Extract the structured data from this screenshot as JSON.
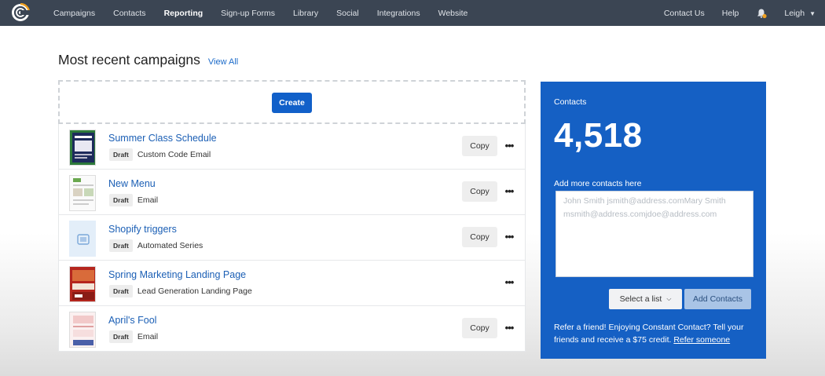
{
  "nav": {
    "items": [
      {
        "label": "Campaigns",
        "active": false
      },
      {
        "label": "Contacts",
        "active": false
      },
      {
        "label": "Reporting",
        "active": true
      },
      {
        "label": "Sign-up Forms",
        "active": false
      },
      {
        "label": "Library",
        "active": false
      },
      {
        "label": "Social",
        "active": false
      },
      {
        "label": "Integrations",
        "active": false
      },
      {
        "label": "Website",
        "active": false
      }
    ],
    "right": {
      "contact_us": "Contact Us",
      "help": "Help",
      "user": "Leigh"
    }
  },
  "campaigns": {
    "heading": "Most recent campaigns",
    "view_all": "View All",
    "create_label": "Create",
    "rows": [
      {
        "title": "Summer Class Schedule",
        "status": "Draft",
        "type": "Custom Code Email",
        "copy": "Copy",
        "thumb": "email-green"
      },
      {
        "title": "New Menu",
        "status": "Draft",
        "type": "Email",
        "copy": "Copy",
        "thumb": "email-light"
      },
      {
        "title": "Shopify triggers",
        "status": "Draft",
        "type": "Automated Series",
        "copy": "Copy",
        "thumb": "automation-blue"
      },
      {
        "title": "Spring Marketing Landing Page",
        "status": "Draft",
        "type": "Lead Generation Landing Page",
        "copy": "",
        "thumb": "landing-red"
      },
      {
        "title": "April's Fool",
        "status": "Draft",
        "type": "Email",
        "copy": "Copy",
        "thumb": "email-pink"
      }
    ]
  },
  "contacts_panel": {
    "label": "Contacts",
    "count": "4,518",
    "add_label": "Add more contacts here",
    "placeholder": "John Smith jsmith@address.comMary Smith msmith@address.comjdoe@address.com",
    "select_list": "Select a list",
    "add_button": "Add Contacts",
    "refer_text": "Refer a friend! Enjoying Constant Contact? Tell your friends and receive a $75 credit.",
    "refer_link": "Refer someone"
  },
  "colors": {
    "nav_bg": "#3b4553",
    "panel_bg": "#1560c4",
    "primary": "#1160c9",
    "link": "#1b5fb5",
    "notification": "#f0a020"
  }
}
